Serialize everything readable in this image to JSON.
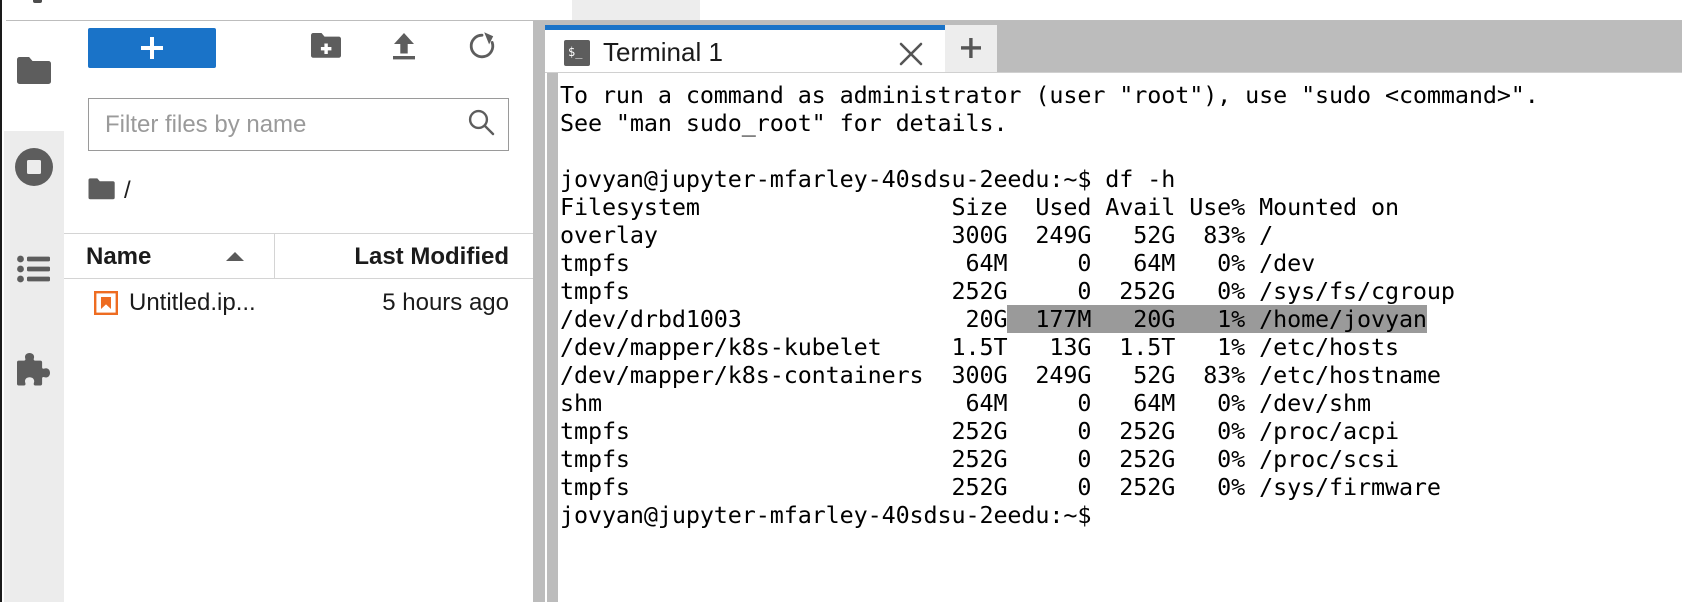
{
  "colors": {
    "accent": "#1a73c8",
    "rail_bg": "#ececec",
    "splitter": "#bcbcbc",
    "selection": "#9a9a9a",
    "notebook_icon": "#ee6c21"
  },
  "sidebar": {
    "items": [
      {
        "name": "file-browser",
        "icon": "folder-icon",
        "label": "File Browser"
      },
      {
        "name": "running-sessions",
        "icon": "stop-circle-icon",
        "label": "Running Terminals and Kernels"
      },
      {
        "name": "table-of-contents",
        "icon": "list-icon",
        "label": "Table of Contents"
      },
      {
        "name": "extension-manager",
        "icon": "puzzle-piece-icon",
        "label": "Extension Manager"
      }
    ]
  },
  "filebrowser": {
    "toolbar": {
      "new_launcher_label": "+",
      "new_folder_label": "New Folder",
      "upload_label": "Upload Files",
      "refresh_label": "Refresh File List"
    },
    "filter": {
      "value": "",
      "placeholder": "Filter files by name"
    },
    "breadcrumb": {
      "path": "/"
    },
    "columns": [
      {
        "label": "Name",
        "sort": "ascending"
      },
      {
        "label": "Last Modified",
        "sort": "none"
      }
    ],
    "rows": [
      {
        "icon": "notebook-icon",
        "name": "Untitled.ip...",
        "modified": "5 hours ago"
      }
    ]
  },
  "dock": {
    "tabs": [
      {
        "label": "Terminal 1",
        "icon": "terminal-icon",
        "active": true,
        "close_label": "×"
      }
    ],
    "add_tab_label": "+"
  },
  "terminal": {
    "prompt": "jovyan@jupyter-mfarley-40sdsu-2eedu:~$",
    "command": "df -h",
    "banner": [
      "To run a command as administrator (user \"root\"), use \"sudo <command>\".",
      "See \"man sudo_root\" for details.",
      ""
    ],
    "df_header": {
      "filesystem": "Filesystem",
      "size": "Size",
      "used": "Used",
      "avail": "Avail",
      "use_pct": "Use%",
      "mounted": "Mounted on"
    },
    "df_rows": [
      {
        "filesystem": "overlay",
        "size": "300G",
        "used": "249G",
        "avail": "52G",
        "use_pct": "83%",
        "mounted": "/",
        "selected": false
      },
      {
        "filesystem": "tmpfs",
        "size": "64M",
        "used": "0",
        "avail": "64M",
        "use_pct": "0%",
        "mounted": "/dev",
        "selected": false
      },
      {
        "filesystem": "tmpfs",
        "size": "252G",
        "used": "0",
        "avail": "252G",
        "use_pct": "0%",
        "mounted": "/sys/fs/cgroup",
        "selected": false
      },
      {
        "filesystem": "/dev/drbd1003",
        "size": "20G",
        "used": "177M",
        "avail": "20G",
        "use_pct": "1%",
        "mounted": "/home/jovyan",
        "selected": true
      },
      {
        "filesystem": "/dev/mapper/k8s-kubelet",
        "size": "1.5T",
        "used": "13G",
        "avail": "1.5T",
        "use_pct": "1%",
        "mounted": "/etc/hosts",
        "selected": false
      },
      {
        "filesystem": "/dev/mapper/k8s-containers",
        "size": "300G",
        "used": "249G",
        "avail": "52G",
        "use_pct": "83%",
        "mounted": "/etc/hostname",
        "selected": false
      },
      {
        "filesystem": "shm",
        "size": "64M",
        "used": "0",
        "avail": "64M",
        "use_pct": "0%",
        "mounted": "/dev/shm",
        "selected": false
      },
      {
        "filesystem": "tmpfs",
        "size": "252G",
        "used": "0",
        "avail": "252G",
        "use_pct": "0%",
        "mounted": "/proc/acpi",
        "selected": false
      },
      {
        "filesystem": "tmpfs",
        "size": "252G",
        "used": "0",
        "avail": "252G",
        "use_pct": "0%",
        "mounted": "/proc/scsi",
        "selected": false
      },
      {
        "filesystem": "tmpfs",
        "size": "252G",
        "used": "0",
        "avail": "252G",
        "use_pct": "0%",
        "mounted": "/sys/firmware",
        "selected": false
      }
    ]
  }
}
